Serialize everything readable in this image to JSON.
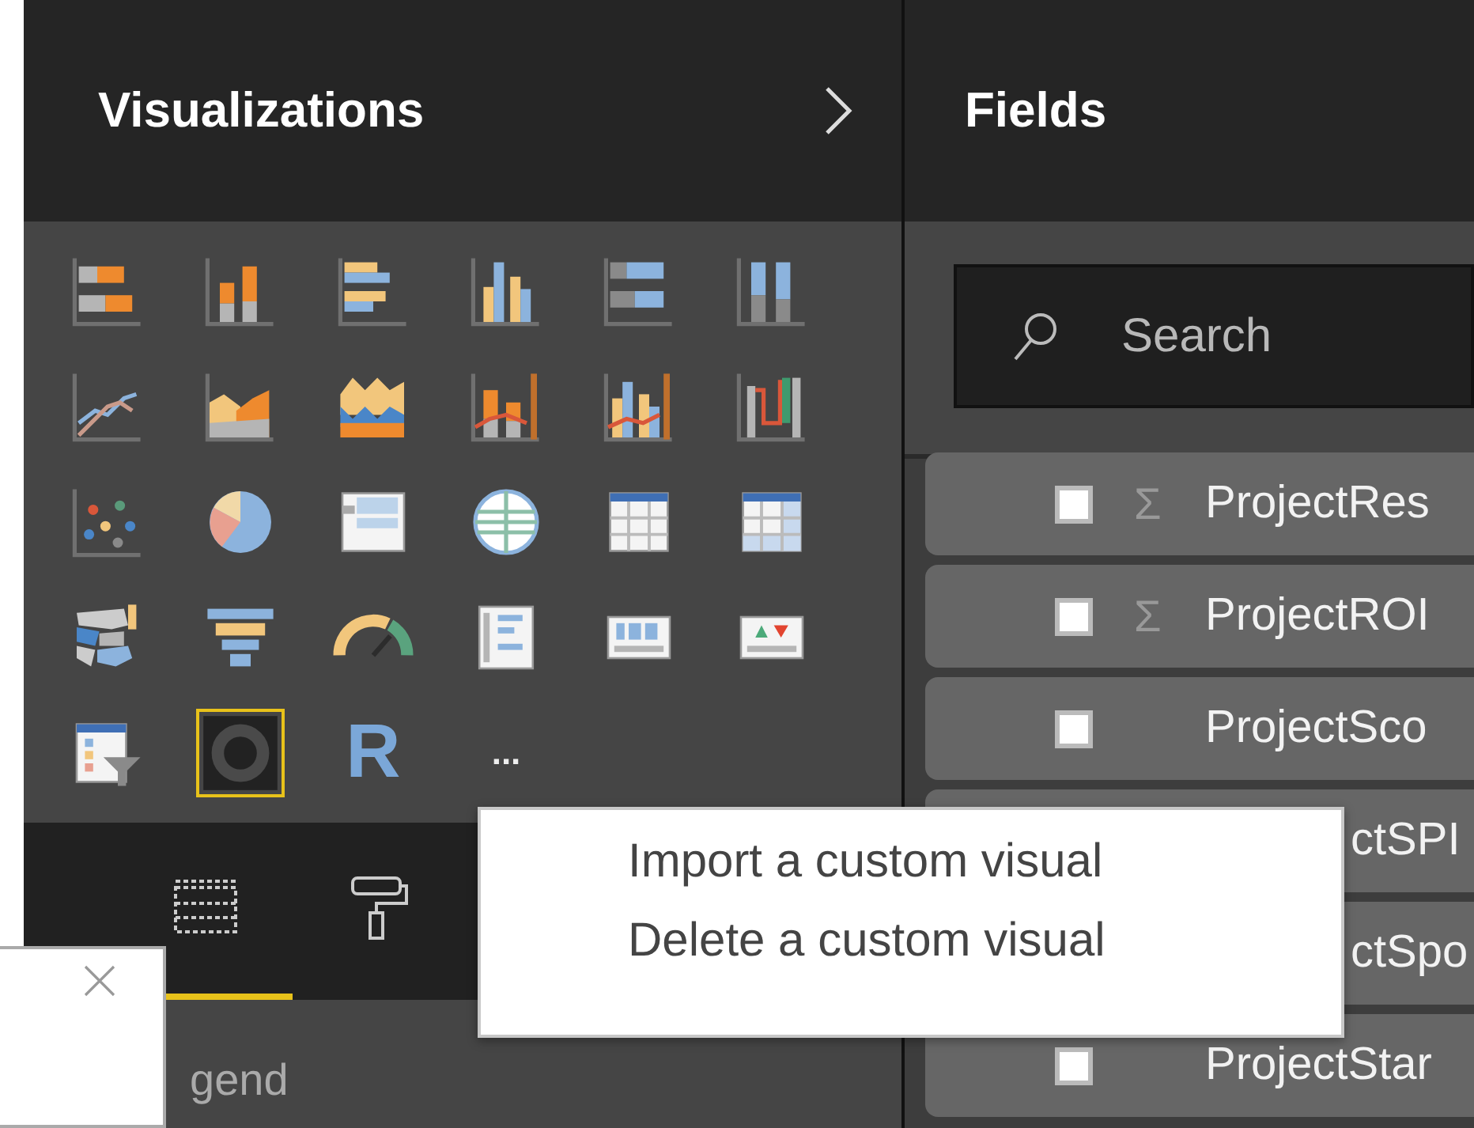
{
  "visualizations": {
    "title": "Visualizations",
    "icons": [
      {
        "kind": "stacked-bar",
        "selected": false
      },
      {
        "kind": "stacked-column",
        "selected": false
      },
      {
        "kind": "clustered-bar",
        "selected": false
      },
      {
        "kind": "clustered-column",
        "selected": false
      },
      {
        "kind": "percent-bar",
        "selected": false
      },
      {
        "kind": "percent-column",
        "selected": false
      },
      {
        "kind": "line",
        "selected": false
      },
      {
        "kind": "area",
        "selected": false
      },
      {
        "kind": "stacked-area",
        "selected": false
      },
      {
        "kind": "line-column",
        "selected": false
      },
      {
        "kind": "line-clustered",
        "selected": false
      },
      {
        "kind": "ribbon",
        "selected": false
      },
      {
        "kind": "scatter",
        "selected": false
      },
      {
        "kind": "pie",
        "selected": false
      },
      {
        "kind": "treemap",
        "selected": false
      },
      {
        "kind": "globe",
        "selected": false
      },
      {
        "kind": "table",
        "selected": false
      },
      {
        "kind": "matrix",
        "selected": false
      },
      {
        "kind": "filled-map",
        "selected": false
      },
      {
        "kind": "funnel",
        "selected": false
      },
      {
        "kind": "gauge",
        "selected": false
      },
      {
        "kind": "multi-card",
        "selected": false
      },
      {
        "kind": "card",
        "selected": false
      },
      {
        "kind": "kpi",
        "selected": false
      },
      {
        "kind": "slicer",
        "selected": false
      },
      {
        "kind": "custom",
        "selected": true
      },
      {
        "kind": "r-script",
        "label": "R",
        "selected": false
      },
      {
        "kind": "more",
        "label": "...",
        "selected": false
      }
    ],
    "tabs": [
      {
        "kind": "fields",
        "selected": true
      },
      {
        "kind": "format",
        "selected": false
      }
    ],
    "section": "gend"
  },
  "fields": {
    "title": "Fields",
    "search": {
      "placeholder": "Search"
    },
    "items": [
      {
        "label": "ProjectRes",
        "symbol": "Σ",
        "checked": false
      },
      {
        "label": "ProjectROI",
        "symbol": "Σ",
        "checked": false
      },
      {
        "label": "ProjectSco",
        "checked": false
      },
      {
        "label": "ctSPI"
      },
      {
        "label": "ctSpo"
      },
      {
        "label": "ProjectStar",
        "checked": false
      }
    ]
  },
  "context_menu": [
    "Import a custom visual",
    "Delete a custom visual"
  ]
}
